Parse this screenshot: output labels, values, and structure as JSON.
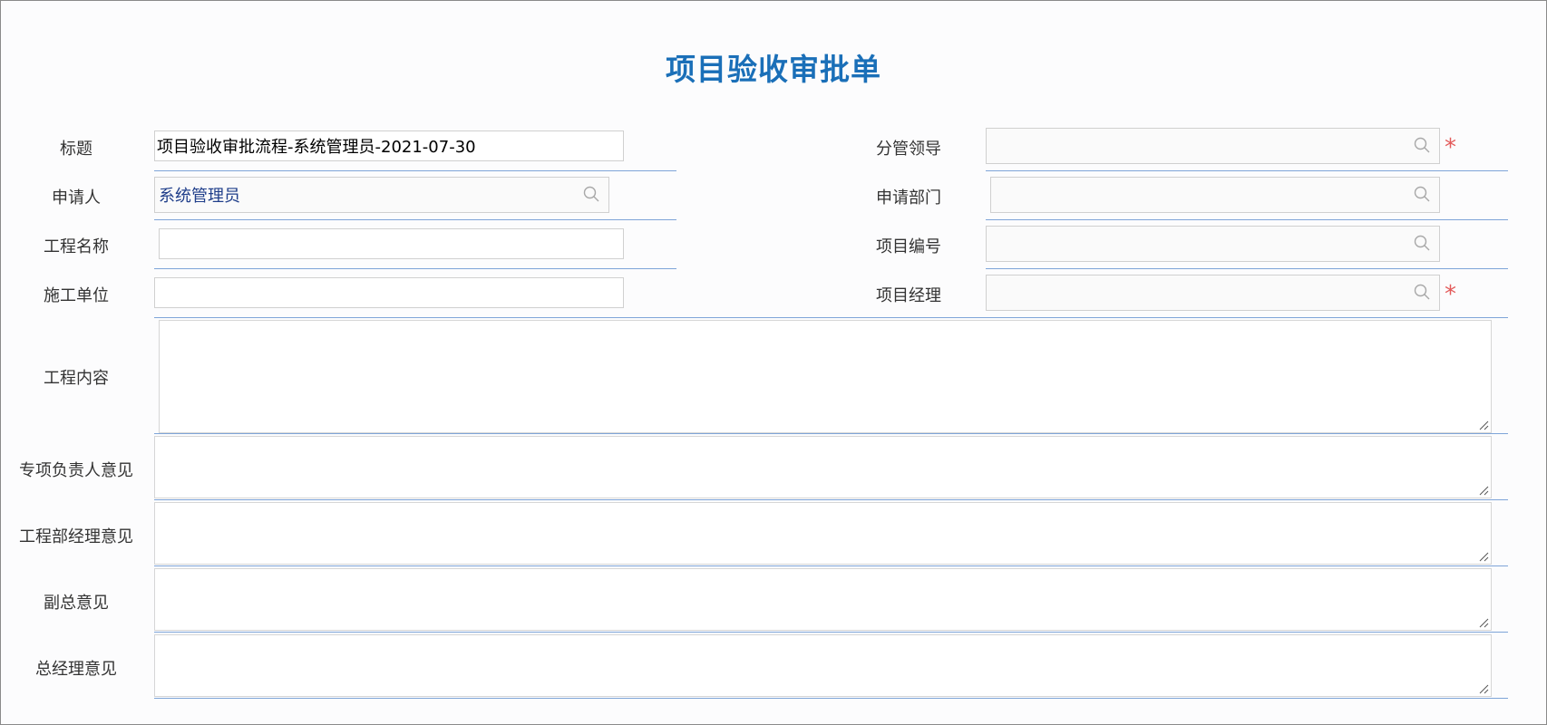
{
  "form": {
    "title": "项目验收审批单",
    "fields": {
      "title_label": "标题",
      "title_value": "项目验收审批流程-系统管理员-2021-07-30",
      "applicant_label": "申请人",
      "applicant_value": "系统管理员",
      "project_name_label": "工程名称",
      "project_name_value": "",
      "construction_unit_label": "施工单位",
      "construction_unit_value": "",
      "leader_label": "分管领导",
      "leader_value": "",
      "dept_label": "申请部门",
      "dept_value": "",
      "project_no_label": "项目编号",
      "project_no_value": "",
      "pm_label": "项目经理",
      "pm_value": "",
      "content_label": "工程内容",
      "special_opinion_label": "专项负责人意见",
      "eng_mgr_opinion_label": "工程部经理意见",
      "vp_opinion_label": "副总意见",
      "gm_opinion_label": "总经理意见"
    },
    "required_mark": "*"
  },
  "colors": {
    "title": "#1a6fb8",
    "divider": "#7ea4d8",
    "required": "#e35b5b",
    "applicant_text": "#1f3e8a"
  },
  "icons": [
    "search-icon",
    "resize-grip-icon",
    "required-star-icon"
  ]
}
